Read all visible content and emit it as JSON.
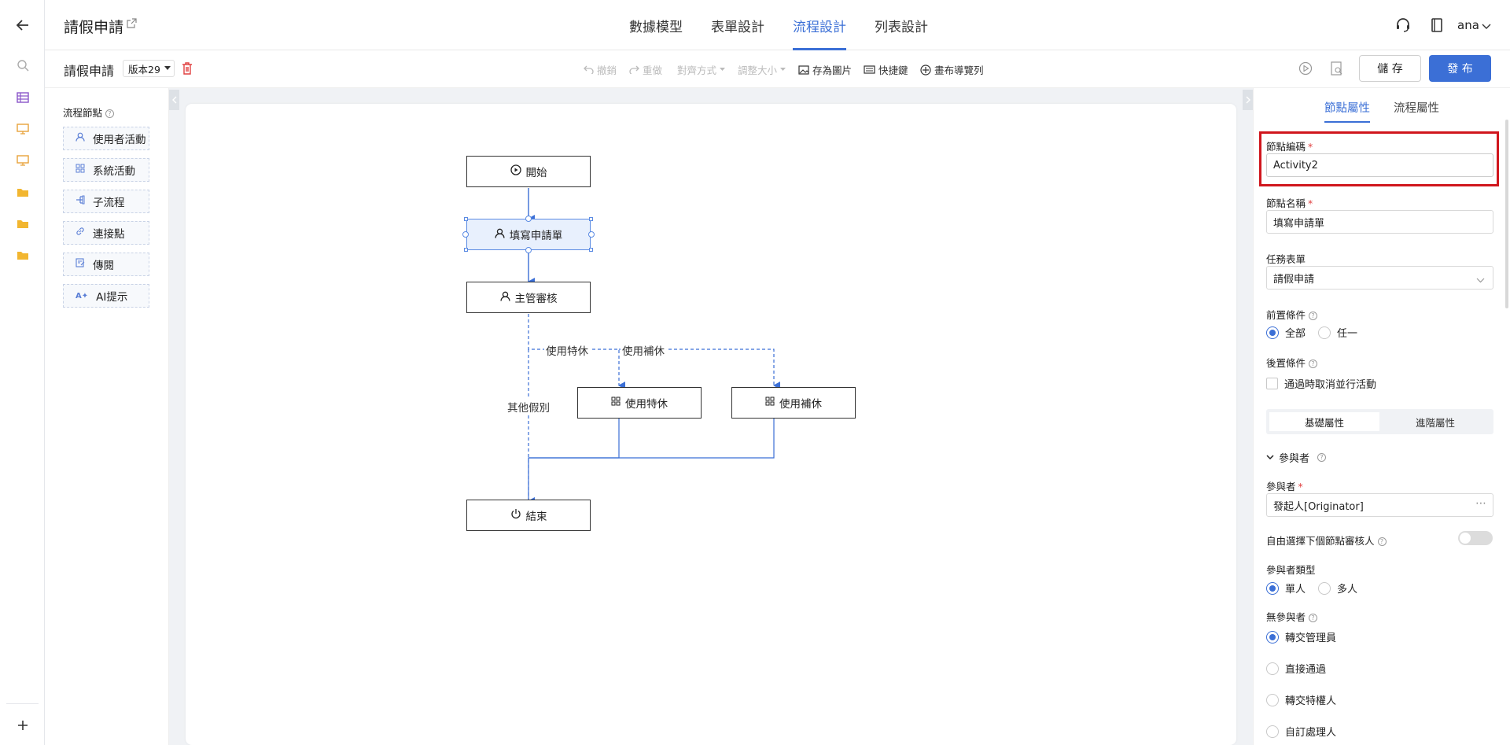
{
  "rail": {
    "icons": [
      "back-arrow-icon",
      "search-icon",
      "table-icon",
      "screen-icon",
      "screen-icon",
      "folder-icon",
      "folder-icon",
      "folder-icon",
      "plus-icon"
    ]
  },
  "header": {
    "title": "請假申請",
    "tabs": [
      {
        "label": "數據模型"
      },
      {
        "label": "表單設計"
      },
      {
        "label": "流程設計"
      },
      {
        "label": "列表設計"
      }
    ],
    "active_tab": "流程設計",
    "user": "ana"
  },
  "toolbar": {
    "process_name": "請假申請",
    "version": "版本29",
    "undo": "撤銷",
    "redo": "重做",
    "align": "對齊方式",
    "resize": "調整大小",
    "save_image": "存為圖片",
    "shortcuts": "快捷鍵",
    "canvas_nav": "畫布導覽列",
    "save": "儲 存",
    "publish": "發 布"
  },
  "palette": {
    "title": "流程節點",
    "items": [
      {
        "label": "使用者活動",
        "icon": "user-icon"
      },
      {
        "label": "系統活動",
        "icon": "grid-icon"
      },
      {
        "label": "子流程",
        "icon": "subprocess-icon"
      },
      {
        "label": "連接點",
        "icon": "link-icon"
      },
      {
        "label": "傳閱",
        "icon": "circulate-icon"
      },
      {
        "label": "AI提示",
        "icon": "ai-icon"
      }
    ]
  },
  "flow": {
    "nodes": {
      "start": "開始",
      "fill": "填寫申請單",
      "manager": "主管審核",
      "special": "使用特休",
      "comp": "使用補休",
      "end": "結束"
    },
    "edges": {
      "special": "使用特休",
      "comp": "使用補休",
      "other": "其他假別"
    }
  },
  "panel": {
    "tabs": [
      {
        "label": "節點屬性"
      },
      {
        "label": "流程屬性"
      }
    ],
    "node_code_label": "節點編碼",
    "node_code_value": "Activity2",
    "node_name_label": "節點名稱",
    "node_name_value": "填寫申請單",
    "task_form_label": "任務表單",
    "task_form_value": "請假申請",
    "pre_cond_label": "前置條件",
    "pre_cond_options": [
      "全部",
      "任一"
    ],
    "post_cond_label": "後置條件",
    "post_cond_checkbox": "通過時取消並行活動",
    "sub_tabs": [
      "基礎屬性",
      "進階屬性"
    ],
    "participants_section": "參與者",
    "participant_label": "參與者",
    "participant_value": "發起人[Originator]",
    "free_select_label": "自由選擇下個節點審核人",
    "participant_type_label": "參與者類型",
    "participant_type_options": [
      "單人",
      "多人"
    ],
    "no_participant_label": "無參與者",
    "no_participant_options": [
      "轉交管理員",
      "直接通過",
      "轉交特權人",
      "自訂處理人"
    ]
  },
  "colors": {
    "accent": "#3b6fd6",
    "highlight": "#d0161d"
  }
}
